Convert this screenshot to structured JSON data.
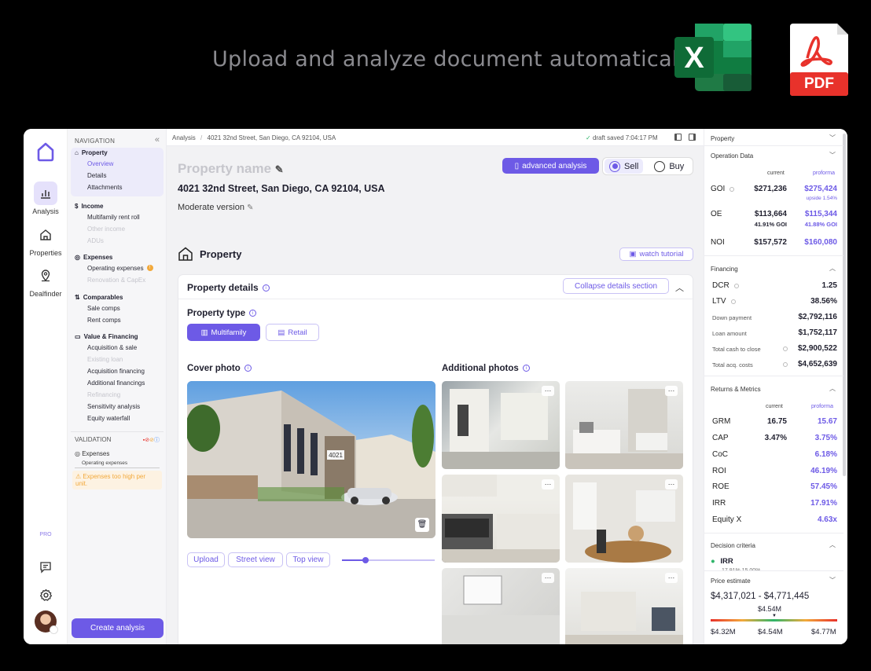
{
  "headline": "Upload and analyze document automatically",
  "pdf_label": "PDF",
  "rail": {
    "items": [
      {
        "label": "Analysis"
      },
      {
        "label": "Properties"
      },
      {
        "label": "Dealfinder"
      }
    ],
    "pro": "PRO"
  },
  "nav": {
    "header": "NAVIGATION",
    "collapse": "«",
    "sections": [
      {
        "title": "Property",
        "items": [
          "Overview",
          "Details",
          "Attachments"
        ]
      },
      {
        "title": "Income",
        "items": [
          "Multifamily rent roll",
          "Other income",
          "ADUs"
        ]
      },
      {
        "title": "Expenses",
        "items": [
          "Operating expenses",
          "Renovation & CapEx"
        ]
      },
      {
        "title": "Comparables",
        "items": [
          "Sale comps",
          "Rent comps"
        ]
      },
      {
        "title": "Value & Financing",
        "items": [
          "Acquisition & sale",
          "Existing loan",
          "Acquisition financing",
          "Additional financings",
          "Refinancing",
          "Sensitivity analysis",
          "Equity waterfall"
        ]
      }
    ],
    "validation": {
      "header": "VALIDATION",
      "item": "Expenses",
      "sub": "Operating expenses",
      "warning": "Expenses too high per unit."
    },
    "create_button": "Create analysis"
  },
  "topbar": {
    "crumb_root": "Analysis",
    "crumb_sep": "/",
    "crumb_current": "4021 32nd Street, San Diego, CA 92104, USA",
    "saved": "draft saved 7:04:17 PM"
  },
  "main": {
    "property_name_placeholder": "Property name",
    "address": "4021 32nd Street, San Diego, CA 92104, USA",
    "version": "Moderate version",
    "advanced_button": "advanced analysis",
    "sell": "Sell",
    "buy": "Buy",
    "section_title": "Property",
    "watch_tutorial": "watch tutorial",
    "card_title": "Property details",
    "collapse_button": "Collapse details section",
    "property_type_label": "Property type",
    "type_multifamily": "Multifamily",
    "type_retail": "Retail",
    "cover_photo_label": "Cover photo",
    "additional_photos_label": "Additional photos",
    "house_number": "4021",
    "buttons": {
      "upload": "Upload",
      "street_view": "Street view",
      "top_view": "Top view"
    },
    "zoom_level": 0.25
  },
  "right_panel": {
    "property": "Property",
    "operation_data": {
      "title": "Operation Data",
      "col_current": "current",
      "col_proforma": "proforma",
      "rows": [
        {
          "label": "GOI",
          "current": "$271,236",
          "proforma": "$275,424",
          "note": "upside 1.54%"
        },
        {
          "label": "OE",
          "current": "$113,664",
          "proforma": "$115,344",
          "current_sub": "41.91% GOI",
          "proforma_sub": "41.88% GOI"
        },
        {
          "label": "NOI",
          "current": "$157,572",
          "proforma": "$160,080"
        }
      ]
    },
    "financing": {
      "title": "Financing",
      "rows": [
        {
          "label": "DCR",
          "value": "1.25"
        },
        {
          "label": "LTV",
          "value": "38.56%"
        },
        {
          "label": "Down payment",
          "value": "$2,792,116"
        },
        {
          "label": "Loan amount",
          "value": "$1,752,117"
        },
        {
          "label": "Total cash to close",
          "value": "$2,900,522"
        },
        {
          "label": "Total acq. costs",
          "value": "$4,652,639"
        }
      ]
    },
    "returns": {
      "title": "Returns & Metrics",
      "col_current": "current",
      "col_proforma": "proforma",
      "rows": [
        {
          "label": "GRM",
          "current": "16.75",
          "proforma": "15.67"
        },
        {
          "label": "CAP",
          "current": "3.47%",
          "proforma": "3.75%"
        },
        {
          "label": "CoC",
          "current": "",
          "proforma": "6.18%"
        },
        {
          "label": "ROI",
          "current": "",
          "proforma": "46.19%"
        },
        {
          "label": "ROE",
          "current": "",
          "proforma": "57.45%"
        },
        {
          "label": "IRR",
          "current": "",
          "proforma": "17.91%"
        },
        {
          "label": "Equity X",
          "current": "",
          "proforma": "4.63x"
        }
      ]
    },
    "decision": {
      "title": "Decision criteria",
      "item": "IRR",
      "item_sub": "17.91% 15.00%"
    },
    "price_estimate": {
      "title": "Price estimate",
      "range": "$4,317,021 - $4,771,445",
      "mid_label": "$4.54M",
      "low": "$4.32M",
      "mid": "$4.54M",
      "high": "$4.77M"
    }
  },
  "colors": {
    "accent": "#6d5ae6",
    "warning": "#f2a93b",
    "success": "#2fb56a"
  }
}
